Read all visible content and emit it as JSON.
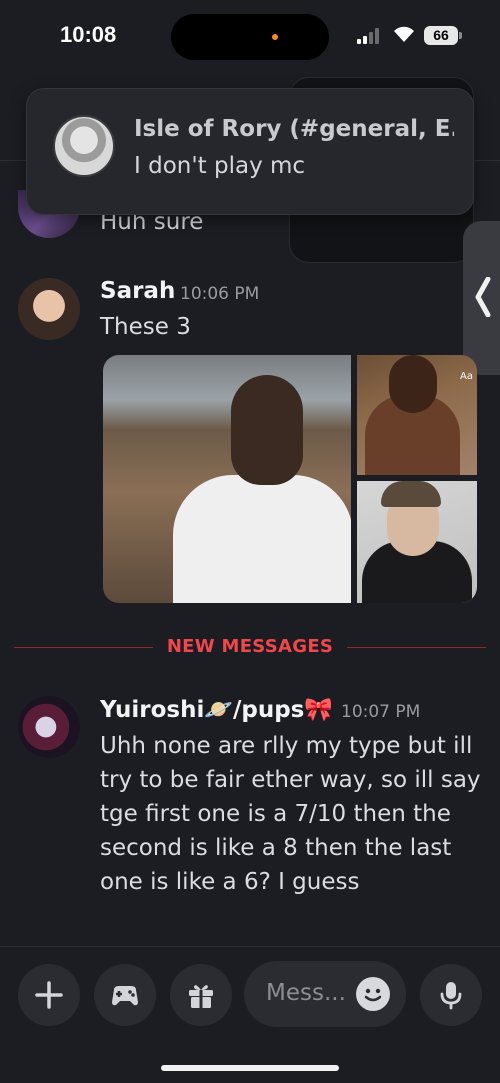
{
  "status_bar": {
    "time": "10:08",
    "battery": "66"
  },
  "notification": {
    "title": "Isle of Rory (#general, E...",
    "body": "I don't play mc"
  },
  "previous_message": {
    "text": "Huh sure"
  },
  "messages": [
    {
      "author": "Sarah",
      "timestamp": "10:06 PM",
      "text": "These 3",
      "attachments": 3
    },
    {
      "author": "Yuiroshi🪐/pups🎀",
      "timestamp": "10:07 PM",
      "lines": [
        "Uhh none are rlly my type but ill",
        "try to be fair ether way, so ill say",
        "tge first one is a 7/10 then the",
        "second is like a 8 then the last",
        "one is like a 6? I guess"
      ]
    }
  ],
  "divider": {
    "label": "NEW MESSAGES"
  },
  "composer": {
    "placeholder": "Mess...",
    "buttons": [
      "plus-icon",
      "gamepad-icon",
      "gift-icon",
      "microphone-icon"
    ]
  },
  "colors": {
    "accent": "#5865f2",
    "new_messages": "#f0474d",
    "background": "#1c1d22"
  }
}
